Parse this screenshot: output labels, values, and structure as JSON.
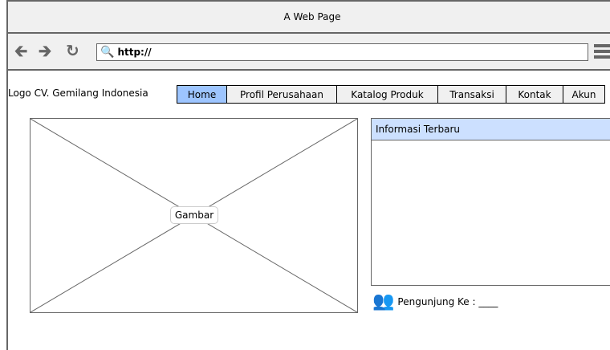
{
  "window": {
    "title": "A Web Page"
  },
  "browser": {
    "back_icon": "arrow-left-icon",
    "forward_icon": "arrow-right-icon",
    "reload_icon": "reload-icon",
    "url": "http://",
    "menu_icon": "hamburger-menu-icon"
  },
  "site": {
    "logo_text": "Logo CV. Gemilang Indonesia",
    "nav": [
      {
        "label": "Home",
        "active": true
      },
      {
        "label": "Profil Perusahaan",
        "active": false
      },
      {
        "label": "Katalog Produk",
        "active": false
      },
      {
        "label": "Transaksi",
        "active": false
      },
      {
        "label": "Kontak",
        "active": false
      },
      {
        "label": "Akun",
        "active": false
      }
    ]
  },
  "main": {
    "image_label": "Gambar",
    "info_title": "Informasi Terbaru",
    "visitor_label": "Pengunjung Ke : ____"
  },
  "colors": {
    "active_tab": "#9dc5ff",
    "panel_header": "#cce0ff",
    "chrome": "#f0f0f0",
    "border": "#666666"
  }
}
